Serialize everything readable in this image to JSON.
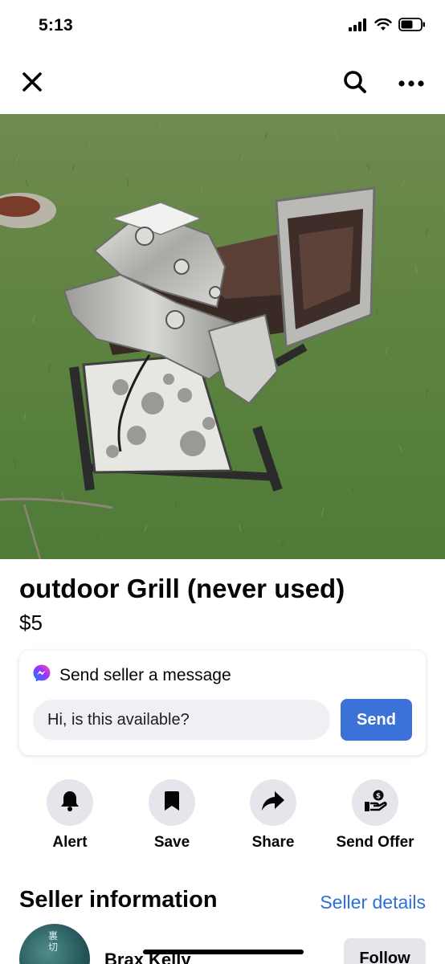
{
  "status_bar": {
    "time": "5:13",
    "icons": [
      "signal-icon",
      "wifi-icon",
      "battery-icon"
    ]
  },
  "nav": {
    "icons": [
      "close-icon",
      "search-icon",
      "more-icon"
    ]
  },
  "photo": {
    "page_count": 5,
    "active_index": 0
  },
  "listing": {
    "title": "outdoor Grill (never used)",
    "price": "$5"
  },
  "message": {
    "header": "Send seller a message",
    "input_value": "Hi, is this available?",
    "send_label": "Send",
    "icon": "messenger-icon"
  },
  "actions": [
    {
      "label": "Alert",
      "icon": "bell-icon"
    },
    {
      "label": "Save",
      "icon": "bookmark-icon"
    },
    {
      "label": "Share",
      "icon": "share-icon"
    },
    {
      "label": "Send Offer",
      "icon": "offer-icon"
    }
  ],
  "seller": {
    "section_title": "Seller information",
    "details_link": "Seller details",
    "name": "Brax Kelly",
    "follow_label": "Follow",
    "avatar_text": "裏切"
  },
  "colors": {
    "accent": "#3a72d8",
    "link": "#2d6fd6",
    "chip_bg": "#e4e6eb"
  }
}
